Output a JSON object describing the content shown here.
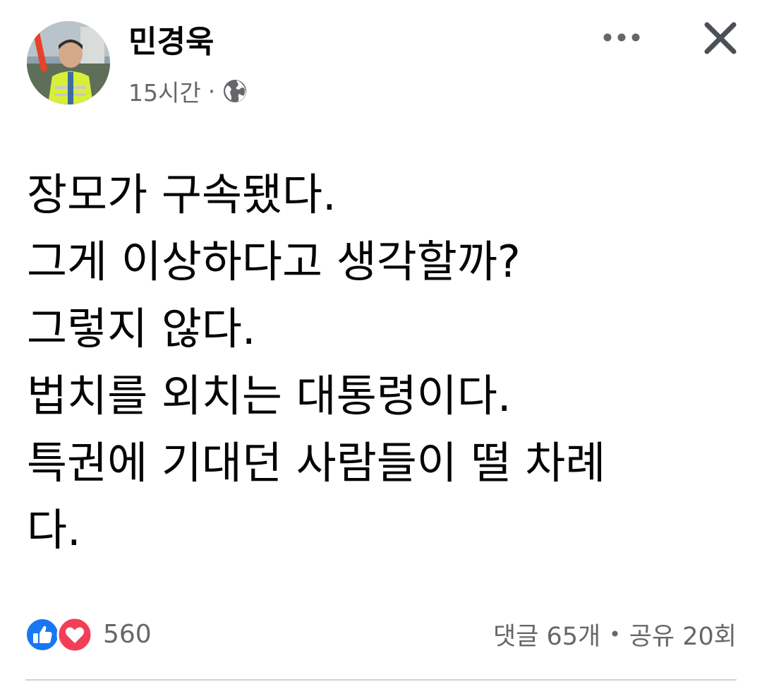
{
  "post": {
    "author_name": "민경욱",
    "timestamp": "15시간",
    "separator": "·",
    "audience_icon": "globe-icon",
    "lines": [
      "장모가 구속됐다.",
      "그게 이상하다고 생각할까?",
      "그렇지 않다.",
      "법치를 외치는 대통령이다.",
      "특권에 기대던 사람들이 떨 차례",
      "다."
    ]
  },
  "actions": {
    "more_icon": "more-horizontal-icon",
    "close_icon": "close-icon"
  },
  "footer": {
    "reaction_icons": [
      "like-icon",
      "love-icon"
    ],
    "reaction_count": "560",
    "comments": "댓글 65개",
    "dot": "•",
    "shares": "공유 20회"
  },
  "colors": {
    "like_blue": "#1877f2",
    "love_red": "#f33e58",
    "secondary_text": "#65676b",
    "primary_text": "#050505",
    "divider": "#ced0d4"
  }
}
